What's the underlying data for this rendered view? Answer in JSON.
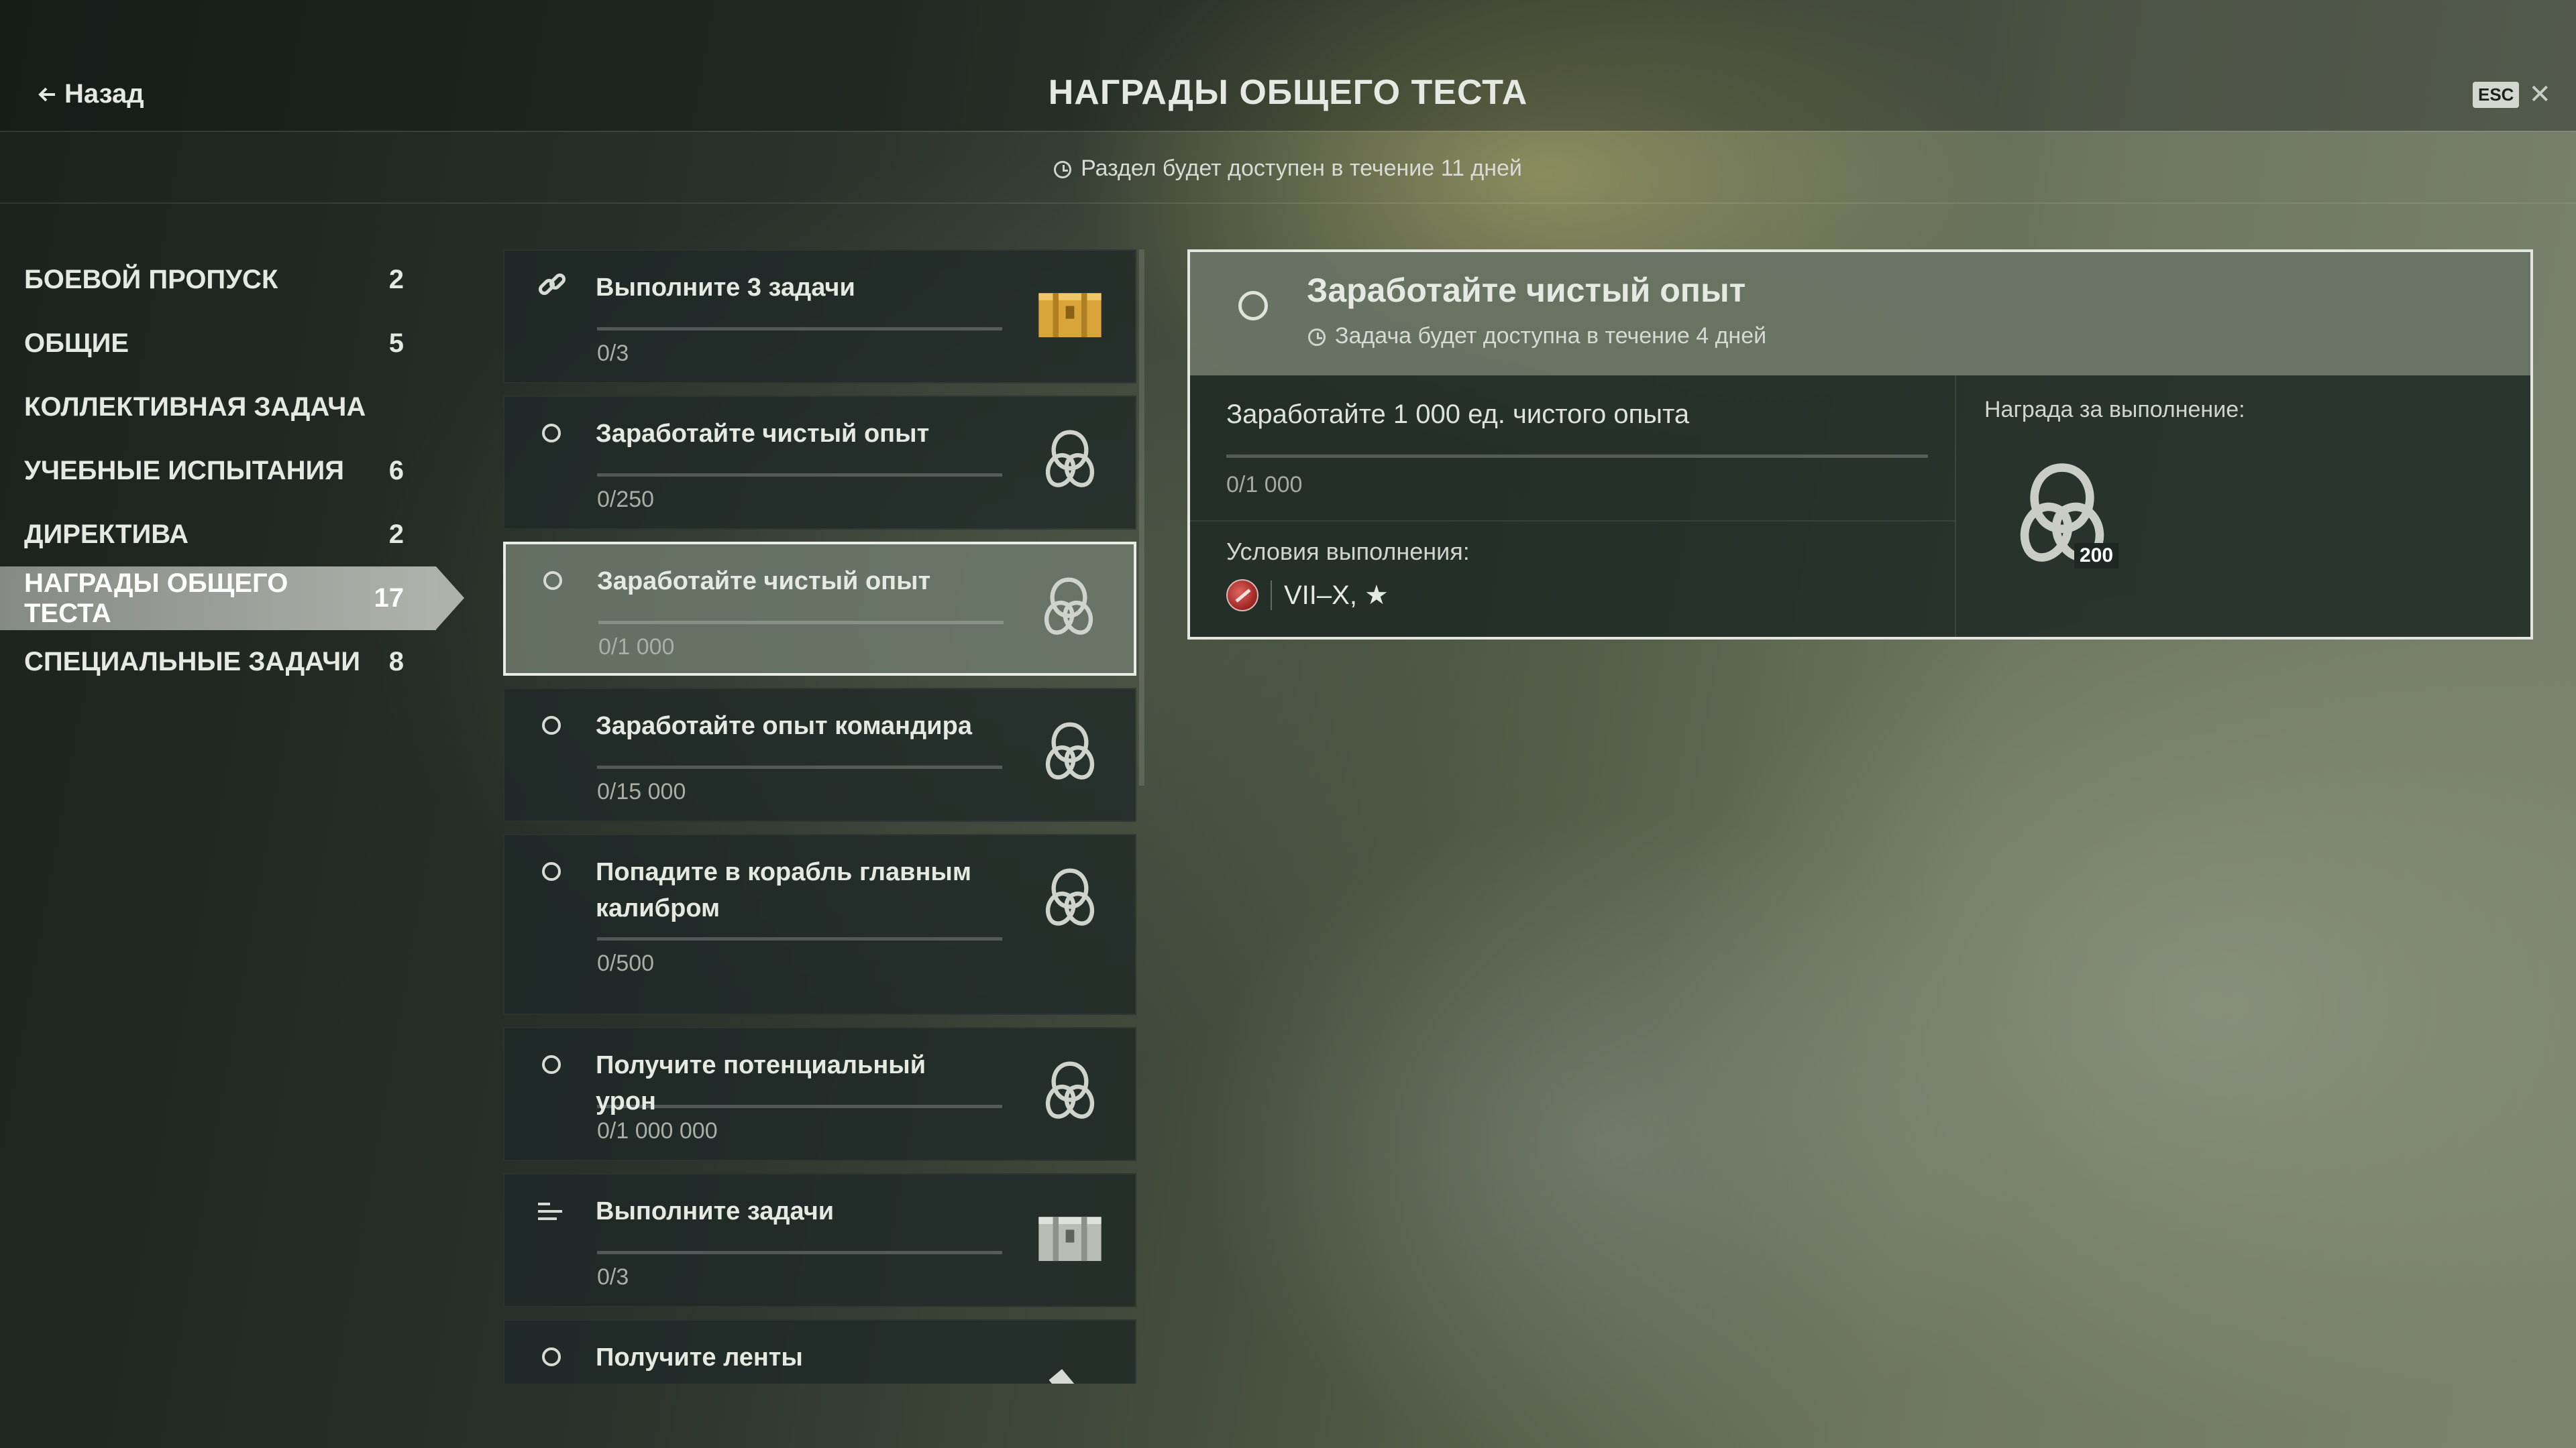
{
  "header": {
    "back_label": "Назад",
    "title": "НАГРАДЫ ОБЩЕГО ТЕСТА",
    "availability": "Раздел будет доступен в течение 11 дней",
    "esc_label": "ESC",
    "close_glyph": "✕"
  },
  "sidebar": {
    "items": [
      {
        "label": "БОЕВОЙ ПРОПУСК",
        "count": "2"
      },
      {
        "label": "ОБЩИЕ",
        "count": "5"
      },
      {
        "label": "КОЛЛЕКТИВНАЯ ЗАДАЧА",
        "count": ""
      },
      {
        "label": "УЧЕБНЫЕ ИСПЫТАНИЯ",
        "count": "6"
      },
      {
        "label": "ДИРЕКТИВА",
        "count": "2"
      },
      {
        "label": "НАГРАДЫ ОБЩЕГО ТЕСТА",
        "count": "17"
      },
      {
        "label": "СПЕЦИАЛЬНЫЕ ЗАДАЧИ",
        "count": "8"
      }
    ],
    "active_index": 5
  },
  "tasks": [
    {
      "title": "Выполните 3 задачи",
      "progress": "0/3",
      "status_icon": "link-icon",
      "reward_icon": "gold-container-icon",
      "progress_fraction": 0
    },
    {
      "title": "Заработайте чистый опыт",
      "progress": "0/250",
      "status_icon": "circle-icon",
      "reward_icon": "chain-icon",
      "progress_fraction": 0
    },
    {
      "title": "Заработайте чистый опыт",
      "progress": "0/1 000",
      "status_icon": "circle-icon",
      "reward_icon": "chain-icon",
      "progress_fraction": 0
    },
    {
      "title": "Заработайте опыт командира",
      "progress": "0/15 000",
      "status_icon": "circle-icon",
      "reward_icon": "chain-icon",
      "progress_fraction": 0
    },
    {
      "title": "Попадите в корабль главным калибром",
      "progress": "0/500",
      "status_icon": "circle-icon",
      "reward_icon": "chain-icon",
      "progress_fraction": 0
    },
    {
      "title": "Получите потенциальный урон",
      "progress": "0/1 000 000",
      "status_icon": "circle-icon",
      "reward_icon": "chain-icon",
      "progress_fraction": 0
    },
    {
      "title": "Выполните задачи",
      "progress": "0/3",
      "status_icon": "list-icon",
      "reward_icon": "silver-container-icon",
      "progress_fraction": 0
    },
    {
      "title": "Получите ленты",
      "progress": "",
      "status_icon": "circle-icon",
      "reward_icon": "ribbon-icon",
      "progress_fraction": 0
    }
  ],
  "active_task_index": 2,
  "detail": {
    "title": "Заработайте чистый опыт",
    "availability": "Задача будет доступна в течение 4 дней",
    "task_text": "Заработайте 1 000 ед. чистого опыта",
    "progress": "0/1 000",
    "conditions_label": "Условия выполнения:",
    "conditions_value": "VII–X, ★",
    "reward_label": "Награда за выполнение:",
    "reward_count": "200",
    "reward_icon": "chain-icon"
  }
}
